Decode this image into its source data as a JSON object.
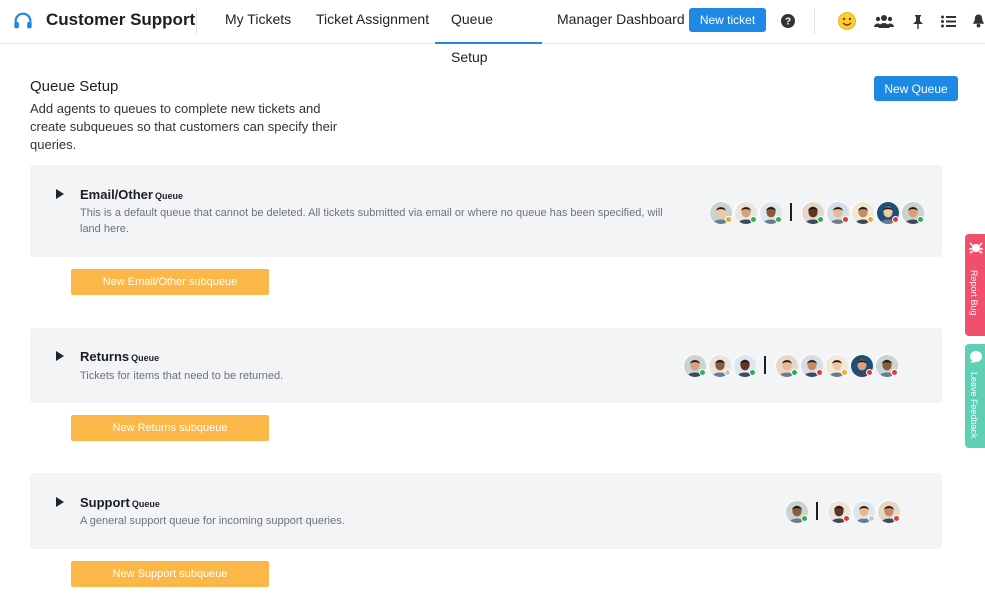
{
  "app": {
    "title": "Customer Support"
  },
  "nav": {
    "tabs": [
      {
        "label": "My Tickets"
      },
      {
        "label": "Ticket Assignment"
      },
      {
        "label": "Queue Setup",
        "active": true
      },
      {
        "label": "Manager Dashboard"
      }
    ],
    "new_ticket_label": "New ticket",
    "icons": [
      "help-icon",
      "smiley-icon",
      "team-icon",
      "pin-icon",
      "list-icon",
      "bell-icon"
    ]
  },
  "page": {
    "title": "Queue Setup",
    "description": "Add agents to queues to complete new tickets and create subqueues so that customers can specify their queries.",
    "new_queue_label": "New Queue"
  },
  "queues": [
    {
      "name": "Email/Other",
      "suffix": "Queue",
      "description": "This is a default queue that cannot be deleted. All tickets submitted via email or where no queue has been specified, will land here.",
      "subqueue_button": "New Email/Other subqueue",
      "managers": [
        "orange",
        "green",
        "green"
      ],
      "agents": [
        "green",
        "red",
        "orange",
        "red",
        "green"
      ]
    },
    {
      "name": "Returns",
      "suffix": "Queue",
      "description": "Tickets for items that need to be returned.",
      "subqueue_button": "New Returns subqueue",
      "managers": [
        "green",
        "grey",
        "green"
      ],
      "agents": [
        "green",
        "red",
        "orange",
        "red",
        "red"
      ]
    },
    {
      "name": "Support",
      "suffix": "Queue",
      "description": "A general support queue for incoming support queries.",
      "subqueue_button": "New Support subqueue",
      "managers": [
        "green"
      ],
      "agents": [
        "red",
        "grey",
        "red"
      ]
    }
  ],
  "side_tabs": {
    "report_bug": "Report Bug",
    "leave_feedback": "Leave Feedback"
  },
  "colors": {
    "accent": "#1e88e5",
    "subqueue_button": "#fbb849",
    "report_bug": "#f0506e",
    "leave_feedback": "#5fd0b5",
    "status_green": "#2bb24c",
    "status_red": "#e53935",
    "status_orange": "#f5a623",
    "status_grey": "#c7c7c7"
  }
}
